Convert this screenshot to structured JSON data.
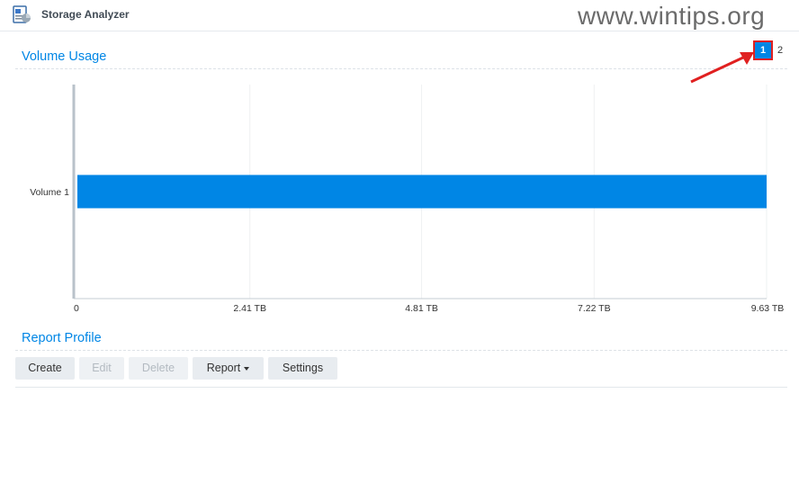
{
  "window": {
    "title": "Storage Analyzer"
  },
  "watermark": "www.wintips.org",
  "volume_usage": {
    "title": "Volume Usage",
    "pages": [
      "1",
      "2"
    ],
    "active_page": "1"
  },
  "chart_data": {
    "type": "bar",
    "orientation": "horizontal",
    "categories": [
      "Volume 1"
    ],
    "series": [
      {
        "values": [
          9.63
        ]
      }
    ],
    "x_ticks": [
      "0",
      "2.41 TB",
      "4.81 TB",
      "7.22 TB",
      "9.63 TB"
    ],
    "x_tick_values": [
      0,
      2.41,
      4.81,
      7.22,
      9.63
    ],
    "xlim": [
      0,
      9.63
    ],
    "grid": true,
    "bar_color": "#0086e5"
  },
  "report_profile": {
    "title": "Report Profile",
    "buttons": {
      "create": "Create",
      "edit": "Edit",
      "delete": "Delete",
      "report": "Report",
      "settings": "Settings"
    }
  },
  "colors": {
    "accent": "#0086e5",
    "highlight": "#e02020"
  }
}
